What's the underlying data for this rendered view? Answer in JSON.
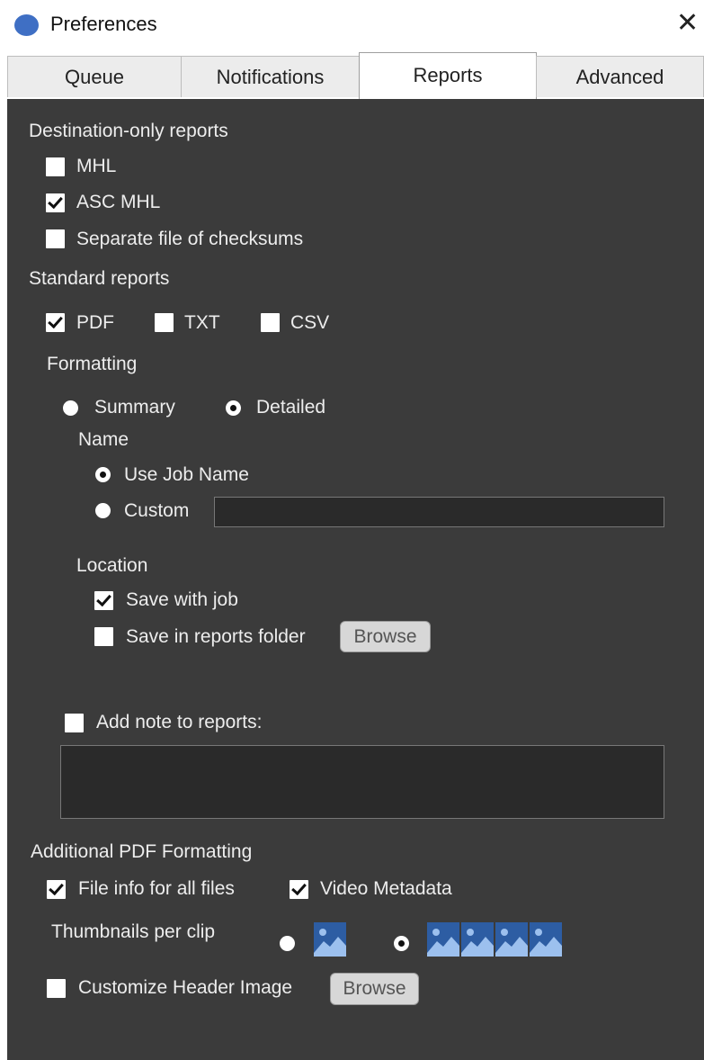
{
  "window": {
    "title": "Preferences",
    "close_glyph": "✕",
    "icon": "app-circle-icon",
    "accent_color": "#3f6fc4"
  },
  "tabs": [
    {
      "label": "Queue",
      "active": false
    },
    {
      "label": "Notifications",
      "active": false
    },
    {
      "label": "Reports",
      "active": true
    },
    {
      "label": "Advanced",
      "active": false
    }
  ],
  "destination_only": {
    "heading": "Destination-only reports",
    "mhl": {
      "label": "MHL",
      "checked": false
    },
    "asc_mhl": {
      "label": "ASC MHL",
      "checked": true
    },
    "separate_checksums": {
      "label": "Separate file of checksums",
      "checked": false
    }
  },
  "standard": {
    "heading": "Standard reports",
    "pdf": {
      "label": "PDF",
      "checked": true
    },
    "txt": {
      "label": "TXT",
      "checked": false
    },
    "csv": {
      "label": "CSV",
      "checked": false
    },
    "formatting_heading": "Formatting",
    "summary": {
      "label": "Summary",
      "selected": false
    },
    "detailed": {
      "label": "Detailed",
      "selected": true
    },
    "name_heading": "Name",
    "use_job_name": {
      "label": "Use Job Name",
      "selected": true
    },
    "custom": {
      "label": "Custom",
      "selected": false,
      "value": ""
    },
    "location_heading": "Location",
    "save_with_job": {
      "label": "Save with job",
      "checked": true
    },
    "save_in_reports_folder": {
      "label": "Save in reports folder",
      "checked": false
    },
    "browse_label": "Browse"
  },
  "note": {
    "label": "Add note to reports:",
    "checked": false,
    "value": ""
  },
  "additional_pdf": {
    "heading": "Additional PDF Formatting",
    "file_info": {
      "label": "File info for all files",
      "checked": true
    },
    "video_metadata": {
      "label": "Video Metadata",
      "checked": true
    },
    "thumbnails_label": "Thumbnails per clip",
    "thumbnail_options": [
      {
        "count": 1,
        "selected": false,
        "icon": "single-thumbnail-icon"
      },
      {
        "count": 4,
        "selected": true,
        "icon": "four-thumbnails-icon"
      }
    ],
    "customize_header": {
      "label": "Customize Header Image",
      "checked": false
    },
    "browse_label": "Browse"
  },
  "colors": {
    "panel_bg": "#3b3b3b",
    "text": "#ededed",
    "thumb_blue": "#2d5da3"
  }
}
